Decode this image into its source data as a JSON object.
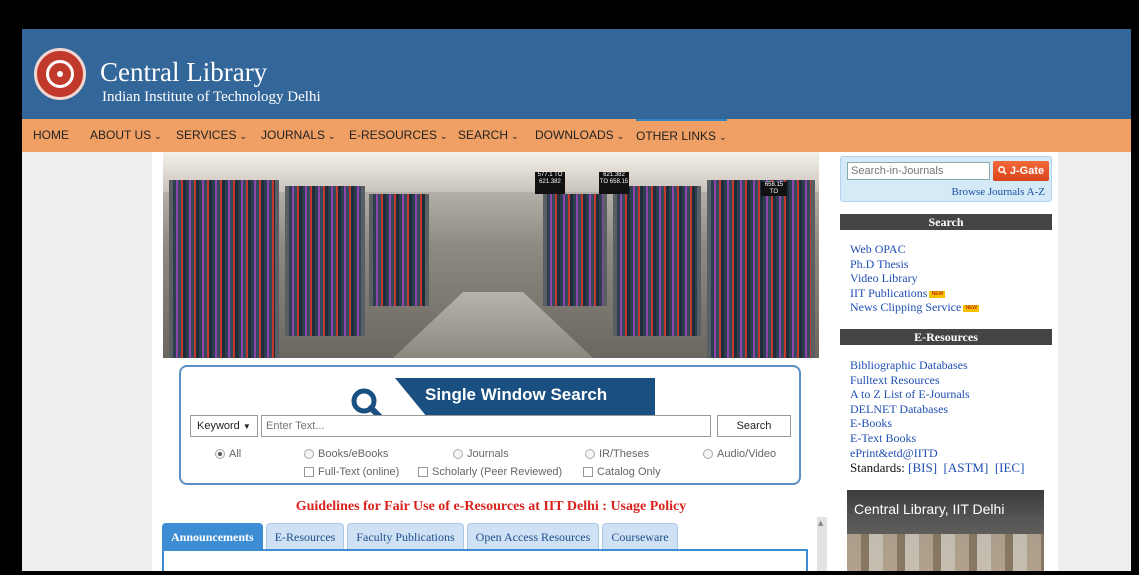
{
  "header": {
    "title": "Central Library",
    "subtitle": "Indian Institute of Technology Delhi"
  },
  "nav": [
    {
      "label": "HOME",
      "caret": ""
    },
    {
      "label": "ABOUT US",
      "caret": "⌄"
    },
    {
      "label": "SERVICES",
      "caret": "⌄"
    },
    {
      "label": "JOURNALS",
      "caret": "⌄"
    },
    {
      "label": "E-RESOURCES",
      "caret": "⌄"
    },
    {
      "label": "SEARCH",
      "caret": "⌄"
    },
    {
      "label": "DOWNLOADS",
      "caret": "⌄"
    },
    {
      "label": "OTHER LINKS",
      "caret": "⌄"
    }
  ],
  "hero": {
    "shelf_labels": [
      "577.1 TO 621.382",
      "621.382 TO 658.15",
      "658.15 TO"
    ]
  },
  "search": {
    "title": "Single Window Search",
    "field_select": "Keyword",
    "select_arrow": "▼",
    "placeholder": "Enter Text...",
    "button": "Search",
    "radios": [
      "All",
      "Books/eBooks",
      "Journals",
      "IR/Theses",
      "Audio/Video"
    ],
    "checkboxes": [
      "Full-Text (online)",
      "Scholarly (Peer Reviewed)",
      "Catalog Only"
    ]
  },
  "guidelines": "Guidelines for Fair Use of e-Resources at IIT Delhi : Usage Policy",
  "tabs": [
    "Announcements",
    "E-Resources",
    "Faculty Publications",
    "Open Access Resources",
    "Courseware"
  ],
  "sidebar": {
    "jgate_placeholder": "Search-in-Journals",
    "jgate_button": "J-Gate",
    "browse": "Browse Journals A-Z",
    "search_heading": "Search",
    "search_links": [
      "Web OPAC",
      "Ph.D Thesis",
      "Video Library",
      "IIT Publications",
      "News Clipping Service"
    ],
    "new_badge": "NEW",
    "eresources_heading": "E-Resources",
    "eresources_links": [
      "Bibliographic Databases",
      "Fulltext Resources",
      "A to Z List of E-Journals",
      "DELNET Databases",
      "E-Books",
      "E-Text Books",
      "ePrint&etd@IITD"
    ],
    "standards_label": "Standards:",
    "standards": [
      "[BIS]",
      "[ASTM]",
      "[IEC]"
    ],
    "video_title": "Central Library, IIT Delhi"
  },
  "colors": {
    "header_bg": "#336699",
    "nav_bg": "#f0a064",
    "guideline_red": "#d8231c",
    "tab_active": "#3c8dd4"
  }
}
